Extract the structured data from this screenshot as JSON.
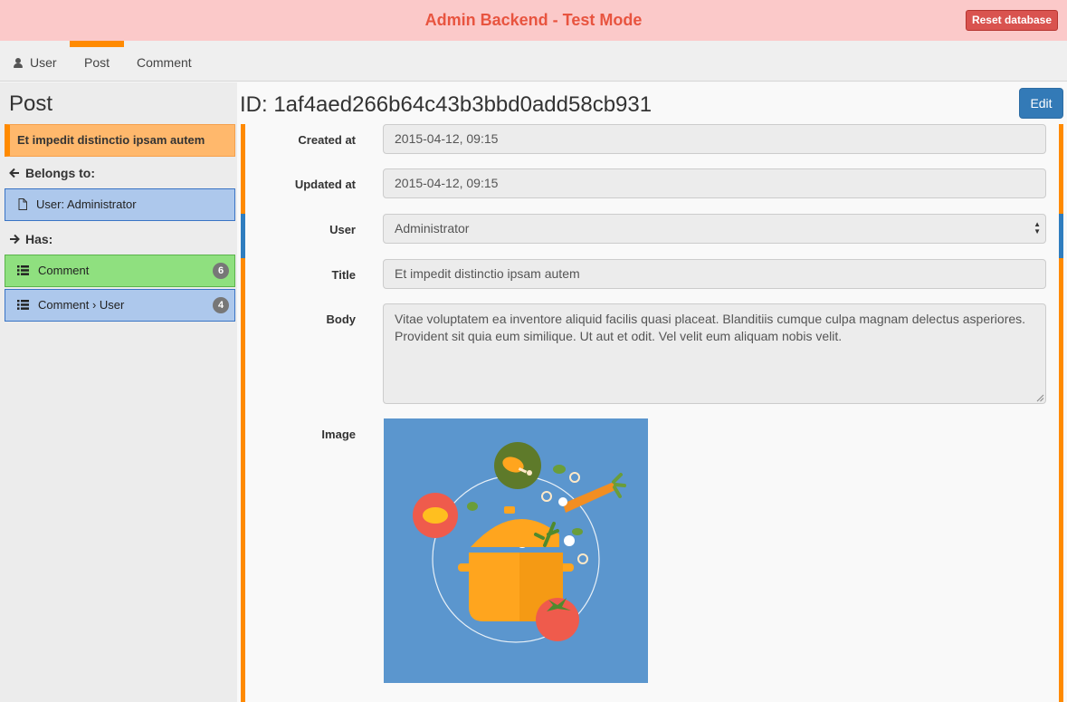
{
  "header": {
    "title": "Admin Backend - Test Mode",
    "reset_label": "Reset database"
  },
  "nav": {
    "items": [
      "User",
      "Post",
      "Comment"
    ],
    "active": "Post"
  },
  "sidebar": {
    "title": "Post",
    "current": "Et impedit distinctio ipsam autem",
    "belongs_label": "Belongs to:",
    "belongs": [
      {
        "label": "User: Administrator"
      }
    ],
    "has_label": "Has:",
    "has": [
      {
        "label": "Comment",
        "count": "6"
      },
      {
        "label": "Comment › User",
        "count": "4"
      }
    ]
  },
  "record": {
    "heading": "ID: 1af4aed266b64c43b3bbd0add58cb931",
    "edit_label": "Edit",
    "fields": [
      {
        "label": "Created at",
        "value": "2015-04-12, 09:15"
      },
      {
        "label": "Updated at",
        "value": "2015-04-12, 09:15"
      },
      {
        "label": "User",
        "value": "Administrator"
      },
      {
        "label": "Title",
        "value": "Et impedit distinctio ipsam autem"
      },
      {
        "label": "Body",
        "value": "Vitae voluptatem ea inventore aliquid facilis quasi placeat. Blanditiis cumque culpa magnam delectus asperiores. Provident sit quia eum similique. Ut aut et odit. Vel velit eum aliquam nobis velit."
      },
      {
        "label": "Image",
        "value": ""
      }
    ]
  },
  "colors": {
    "accent": "#ff8a00",
    "relation": "#2f7dbf",
    "header_bg": "#fbc9c9",
    "title": "#e8543f",
    "primary": "#337ab7",
    "danger": "#d9534f"
  },
  "icons": [
    "user-icon",
    "arrow-left-icon",
    "file-icon",
    "arrow-right-icon",
    "list-icon",
    "select-arrows-icon"
  ]
}
